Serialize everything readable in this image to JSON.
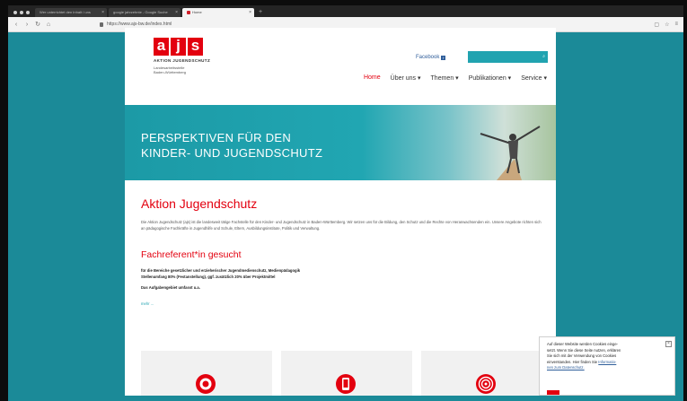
{
  "browser": {
    "tabs": [
      {
        "label": "Wer unterrichtet den Inhalt / uns"
      },
      {
        "label": "google jahrzehnte - Google Suche"
      },
      {
        "label": "Home",
        "active": true
      }
    ],
    "url": "https://www.ajs-bw.de/index.html"
  },
  "site": {
    "logo_letters": [
      "a",
      "j",
      "s"
    ],
    "logo_org": "AKTION JUGENDSCHUTZ",
    "logo_line1": "Landesarbeitsstelle",
    "logo_line2": "Baden-Württemberg",
    "facebook_label": "Facebook",
    "menu": [
      {
        "label": "Home",
        "active": true
      },
      {
        "label": "Über uns"
      },
      {
        "label": "Themen"
      },
      {
        "label": "Publikationen"
      },
      {
        "label": "Service"
      }
    ],
    "banner_line1": "PERSPEKTIVEN FÜR DEN",
    "banner_line2": "KINDER- UND JUGENDSCHUTZ",
    "heading": "Aktion Jugendschutz",
    "intro": "Die Aktion Jugendschutz (ajs) ist die landesweit tätige Fachstelle für den Kinder- und Jugendschutz in Baden-Württemberg. Wir setzen uns für die Bildung, den Schutz und die Rechte von Heranwachsenden ein. Unsere Angebote richten sich an pädagogische Fachkräfte in Jugendhilfe und Schule, Eltern, Ausbildungsinstitute, Politik und Verwaltung.",
    "job_heading": "Fachreferent*in gesucht",
    "job_line1": "für die Bereiche gesetzlicher und erzieherischer Jugendmedienschutz, Medienpädagogik",
    "job_line2": "Stellenumfang 80% (Festanstellung), ggf. zusätzlich 20% über Projektmittel",
    "job_line3": "Das Aufgabengebiet umfasst u.a.",
    "more_link": "mehr ...",
    "colors": {
      "accent": "#e3000f",
      "teal": "#21a3b0",
      "bg": "#1b8a98"
    }
  },
  "cookie": {
    "line1": "Auf dieser Website werden Cookies einge-",
    "line2": "setzt. Wenn Sie diese Seite nutzen, erklären",
    "line3": "Sie sich mit der Verwendung von Cookies",
    "line4": "einverstanden. Hier finden Sie",
    "link1": "Informatio-",
    "link2": "nen zum Datenschutz."
  }
}
